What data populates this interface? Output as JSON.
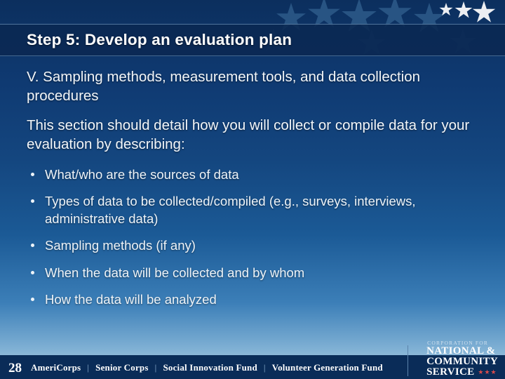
{
  "slide": {
    "title": "Step 5: Develop an evaluation plan",
    "page_number": "28",
    "lead_paragraphs": [
      "V. Sampling methods, measurement tools, and data collection procedures",
      "This section should detail how you will collect or compile data for your evaluation by describing:"
    ],
    "bullets": [
      "What/who are the sources of data",
      "Types of data to be collected/compiled (e.g., surveys, interviews, administrative data)",
      "Sampling methods (if any)",
      "When the data will be collected and by whom",
      "How the data will be analyzed"
    ]
  },
  "footer": {
    "brands": [
      "AmeriCorps",
      "Senior Corps",
      "Social Innovation Fund",
      "Volunteer Generation Fund"
    ],
    "separator": "|",
    "logo": {
      "pre": "CORPORATION FOR",
      "line1": "NATIONAL &",
      "line2": "COMMUNITY",
      "line3": "SERVICE",
      "stars": "★★★"
    }
  },
  "colors": {
    "background_top": "#0c2f5e",
    "background_bottom": "#b9d3e6",
    "title_bar": "#0a2852",
    "footer_bar": "#0a2c58",
    "text": "#ffffff",
    "star_light": "#2d5c8c",
    "logo_stars": "#d94b4b"
  }
}
